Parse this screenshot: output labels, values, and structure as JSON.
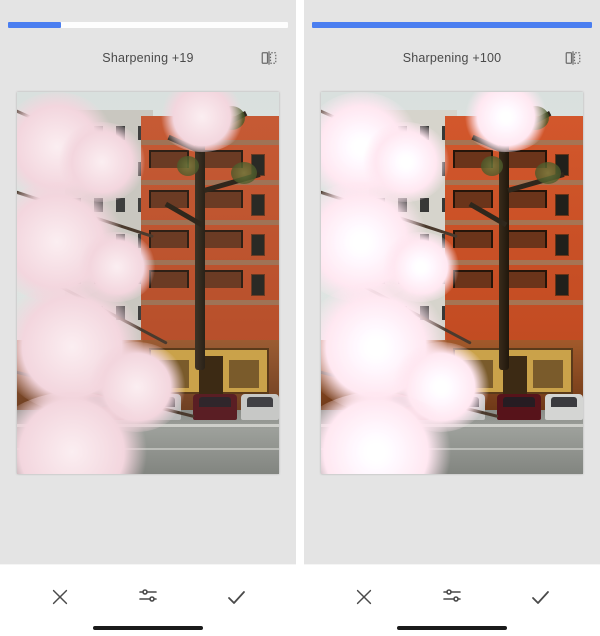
{
  "panels": [
    {
      "filter_name": "Sharpening",
      "filter_value": 19,
      "filter_label": "Sharpening +19",
      "slider_percent": 19,
      "compare_icon": "compare-icon"
    },
    {
      "filter_name": "Sharpening",
      "filter_value": 100,
      "filter_label": "Sharpening +100",
      "slider_percent": 100,
      "compare_icon": "compare-icon"
    }
  ],
  "toolbar": {
    "cancel_icon": "close-icon",
    "adjust_icon": "sliders-icon",
    "confirm_icon": "check-icon"
  },
  "colors": {
    "slider_fill": "#4a7ef0",
    "panel_bg": "#e4e4e4",
    "text": "#4a4a4a"
  }
}
